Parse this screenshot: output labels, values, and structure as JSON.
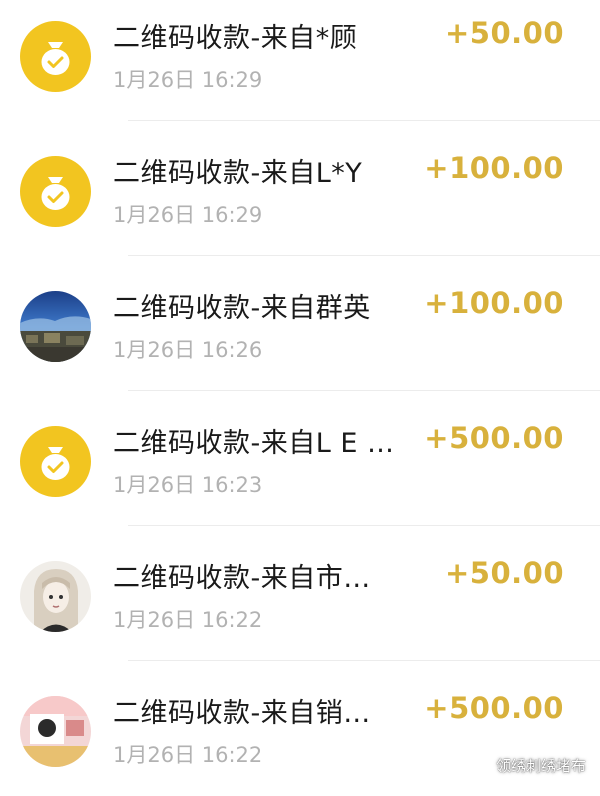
{
  "colors": {
    "coin_background": "#f2c520",
    "amount_text": "#d8b13c",
    "time_text": "#b2b2b2",
    "title_text": "#1a1a1a"
  },
  "transactions": [
    {
      "title": "二维码收款-来自*顾",
      "time": "1月26日 16:29",
      "amount": "+50.00",
      "avatar": "coin-bag-icon"
    },
    {
      "title": "二维码收款-来自L*Y",
      "time": "1月26日 16:29",
      "amount": "+100.00",
      "avatar": "coin-bag-icon"
    },
    {
      "title": "二维码收款-来自群英",
      "time": "1月26日 16:26",
      "amount": "+100.00",
      "avatar": "user-photo-night-scene"
    },
    {
      "title": "二维码收款-来自L E …",
      "time": "1月26日 16:23",
      "amount": "+500.00",
      "avatar": "coin-bag-icon"
    },
    {
      "title": "二维码收款-来自市…",
      "time": "1月26日 16:22",
      "amount": "+50.00",
      "avatar": "user-photo-anime-girl"
    },
    {
      "title": "二维码收款-来自销…",
      "time": "1月26日 16:22",
      "amount": "+500.00",
      "avatar": "user-photo-collage"
    }
  ],
  "watermark": {
    "text": "领绣刺绣堵布",
    "icon": "wechat-icon"
  }
}
